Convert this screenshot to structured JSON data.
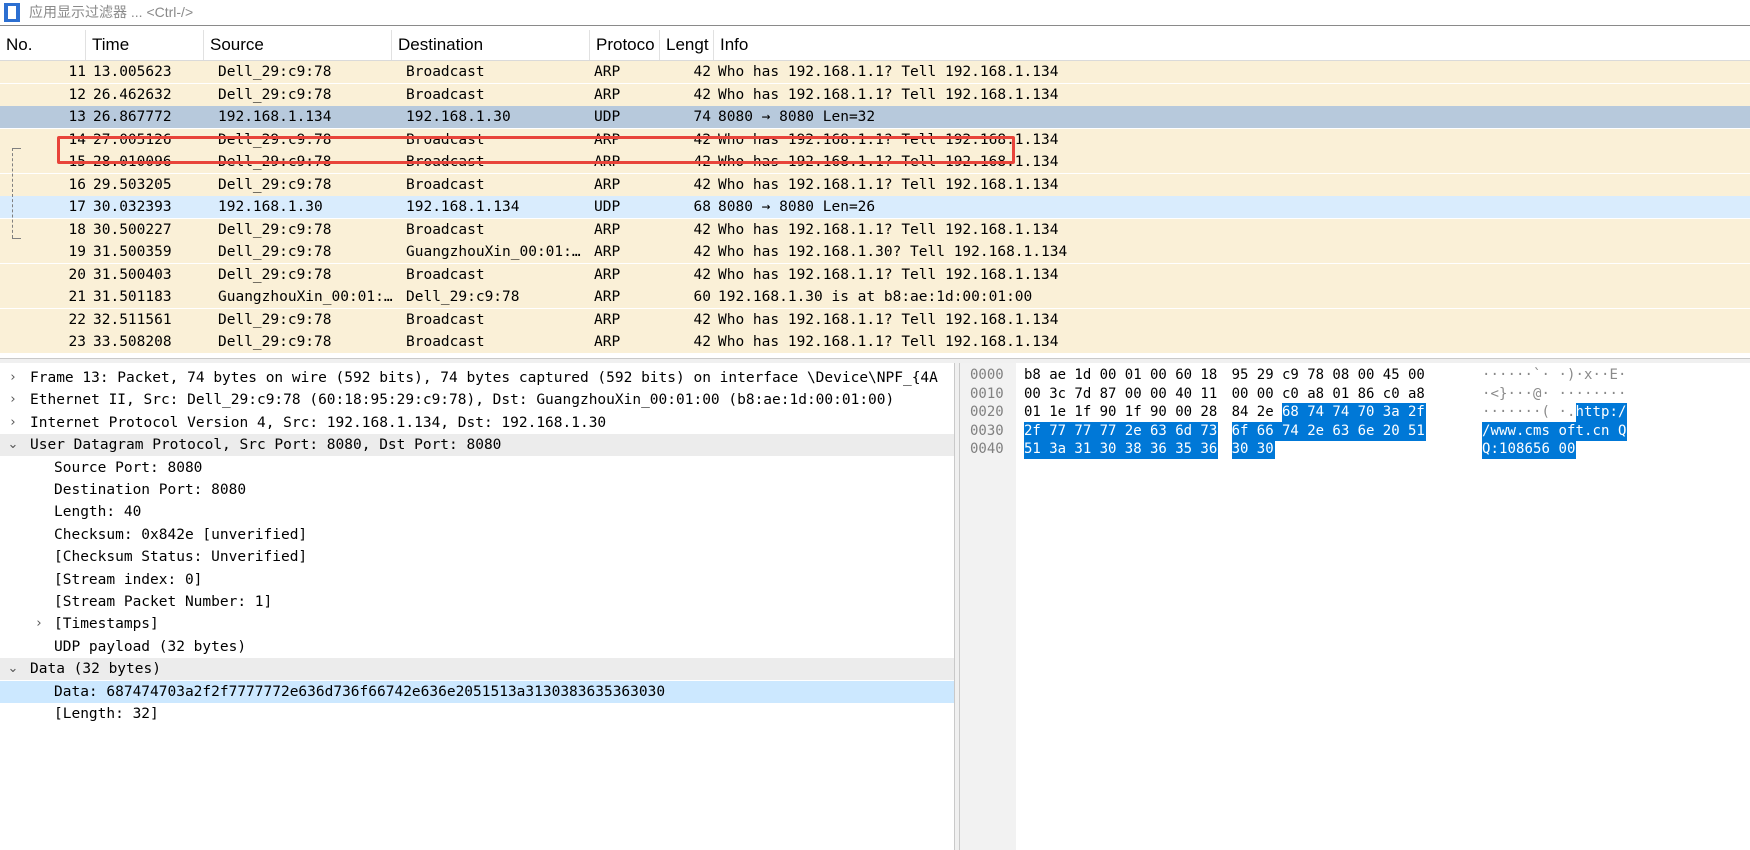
{
  "filter": {
    "placeholder": "应用显示过滤器 ... <Ctrl-/>"
  },
  "columns": [
    "No.",
    "Time",
    "Source",
    "Destination",
    "Protoco",
    "Lengt",
    "Info"
  ],
  "packets": [
    {
      "no": "11",
      "time": "13.005623",
      "src": "Dell_29:c9:78",
      "dst": "Broadcast",
      "proto": "ARP",
      "len": "42",
      "info": "Who has 192.168.1.1? Tell 192.168.1.134"
    },
    {
      "no": "12",
      "time": "26.462632",
      "src": "Dell_29:c9:78",
      "dst": "Broadcast",
      "proto": "ARP",
      "len": "42",
      "info": "Who has 192.168.1.1? Tell 192.168.1.134"
    },
    {
      "no": "13",
      "time": "26.867772",
      "src": "192.168.1.134",
      "dst": "192.168.1.30",
      "proto": "UDP",
      "len": "74",
      "info": "8080 → 8080 Len=32"
    },
    {
      "no": "14",
      "time": "27.005126",
      "src": "Dell_29:c9:78",
      "dst": "Broadcast",
      "proto": "ARP",
      "len": "42",
      "info": "Who has 192.168.1.1? Tell 192.168.1.134"
    },
    {
      "no": "15",
      "time": "28.010096",
      "src": "Dell_29:c9:78",
      "dst": "Broadcast",
      "proto": "ARP",
      "len": "42",
      "info": "Who has 192.168.1.1? Tell 192.168.1.134"
    },
    {
      "no": "16",
      "time": "29.503205",
      "src": "Dell_29:c9:78",
      "dst": "Broadcast",
      "proto": "ARP",
      "len": "42",
      "info": "Who has 192.168.1.1? Tell 192.168.1.134"
    },
    {
      "no": "17",
      "time": "30.032393",
      "src": "192.168.1.30",
      "dst": "192.168.1.134",
      "proto": "UDP",
      "len": "68",
      "info": "8080 → 8080 Len=26"
    },
    {
      "no": "18",
      "time": "30.500227",
      "src": "Dell_29:c9:78",
      "dst": "Broadcast",
      "proto": "ARP",
      "len": "42",
      "info": "Who has 192.168.1.1? Tell 192.168.1.134"
    },
    {
      "no": "19",
      "time": "31.500359",
      "src": "Dell_29:c9:78",
      "dst": "GuangzhouXin_00:01:…",
      "proto": "ARP",
      "len": "42",
      "info": "Who has 192.168.1.30? Tell 192.168.1.134"
    },
    {
      "no": "20",
      "time": "31.500403",
      "src": "Dell_29:c9:78",
      "dst": "Broadcast",
      "proto": "ARP",
      "len": "42",
      "info": "Who has 192.168.1.1? Tell 192.168.1.134"
    },
    {
      "no": "21",
      "time": "31.501183",
      "src": "GuangzhouXin_00:01:…",
      "dst": "Dell_29:c9:78",
      "proto": "ARP",
      "len": "60",
      "info": "192.168.1.30 is at b8:ae:1d:00:01:00"
    },
    {
      "no": "22",
      "time": "32.511561",
      "src": "Dell_29:c9:78",
      "dst": "Broadcast",
      "proto": "ARP",
      "len": "42",
      "info": "Who has 192.168.1.1? Tell 192.168.1.134"
    },
    {
      "no": "23",
      "time": "33.508208",
      "src": "Dell_29:c9:78",
      "dst": "Broadcast",
      "proto": "ARP",
      "len": "42",
      "info": "Who has 192.168.1.1? Tell 192.168.1.134"
    }
  ],
  "details": [
    {
      "text": "Frame 13: Packet, 74 bytes on wire (592 bits), 74 bytes captured (592 bits) on interface \\Device\\NPF_{4A",
      "arrow": "›"
    },
    {
      "text": "Ethernet II, Src: Dell_29:c9:78 (60:18:95:29:c9:78), Dst: GuangzhouXin_00:01:00 (b8:ae:1d:00:01:00)",
      "arrow": "›"
    },
    {
      "text": "Internet Protocol Version 4, Src: 192.168.1.134, Dst: 192.168.1.30",
      "arrow": "›"
    },
    {
      "text": "User Datagram Protocol, Src Port: 8080, Dst Port: 8080",
      "arrow": "⌄"
    },
    {
      "text": "Source Port: 8080",
      "arrow": ""
    },
    {
      "text": "Destination Port: 8080",
      "arrow": ""
    },
    {
      "text": "Length: 40",
      "arrow": ""
    },
    {
      "text": "Checksum: 0x842e [unverified]",
      "arrow": ""
    },
    {
      "text": "[Checksum Status: Unverified]",
      "arrow": ""
    },
    {
      "text": "[Stream index: 0]",
      "arrow": ""
    },
    {
      "text": "[Stream Packet Number: 1]",
      "arrow": ""
    },
    {
      "text": "[Timestamps]",
      "arrow": "›"
    },
    {
      "text": "UDP payload (32 bytes)",
      "arrow": ""
    },
    {
      "text": "Data (32 bytes)",
      "arrow": "⌄"
    },
    {
      "text": "Data: 687474703a2f2f7777772e636d736f66742e636e2051513a3130383635363030",
      "arrow": ""
    },
    {
      "text": "[Length: 32]",
      "arrow": ""
    }
  ],
  "hex": [
    {
      "off": "0000",
      "bytes": [
        "b8",
        "ae",
        "1d",
        "00",
        "01",
        "00",
        "60",
        "18",
        "95",
        "29",
        "c9",
        "78",
        "08",
        "00",
        "45",
        "00"
      ],
      "ascii": [
        "·",
        "·",
        "·",
        "·",
        "·",
        "·",
        "`",
        "·",
        "·",
        ")",
        "·",
        "x",
        "·",
        "·",
        "E",
        "·"
      ]
    },
    {
      "off": "0010",
      "bytes": [
        "00",
        "3c",
        "7d",
        "87",
        "00",
        "00",
        "40",
        "11",
        "00",
        "00",
        "c0",
        "a8",
        "01",
        "86",
        "c0",
        "a8"
      ],
      "ascii": [
        "·",
        "<",
        "}",
        "·",
        "·",
        "·",
        "@",
        "·",
        "·",
        "·",
        "·",
        "·",
        "·",
        "·",
        "·",
        "·"
      ]
    },
    {
      "off": "0020",
      "bytes": [
        "01",
        "1e",
        "1f",
        "90",
        "1f",
        "90",
        "00",
        "28",
        "84",
        "2e",
        "68",
        "74",
        "74",
        "70",
        "3a",
        "2f"
      ],
      "ascii": [
        "·",
        "·",
        "·",
        "·",
        "·",
        "·",
        "·",
        "(",
        "·",
        ".",
        "h",
        "t",
        "t",
        "p",
        ":",
        "/"
      ]
    },
    {
      "off": "0030",
      "bytes": [
        "2f",
        "77",
        "77",
        "77",
        "2e",
        "63",
        "6d",
        "73",
        "6f",
        "66",
        "74",
        "2e",
        "63",
        "6e",
        "20",
        "51"
      ],
      "ascii": [
        "/",
        "w",
        "w",
        "w",
        ".",
        "c",
        "m",
        "s",
        "o",
        "f",
        "t",
        ".",
        "c",
        "n",
        " ",
        "Q"
      ]
    },
    {
      "off": "0040",
      "bytes": [
        "51",
        "3a",
        "31",
        "30",
        "38",
        "36",
        "35",
        "36",
        "30",
        "30"
      ],
      "ascii": [
        "Q",
        ":",
        "1",
        "0",
        "8",
        "6",
        "5",
        "6",
        "0",
        "0"
      ]
    }
  ],
  "colors": {
    "arp_row": "#faf0d7",
    "selected_row": "#b7c9dc",
    "related_row": "#d9ecfd",
    "highlight": "#0078d7",
    "red_box": "#e8443a"
  }
}
